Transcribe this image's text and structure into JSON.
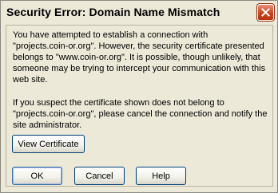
{
  "window": {
    "title": "Security Error: Domain Name Mismatch"
  },
  "message": {
    "paragraph1": "You have attempted to establish a connection with\n\"projects.coin-or.org\". However, the security certificate presented\nbelongs to \"www.coin-or.org\". It is possible, though unlikely, that\nsomeone may be trying to intercept your communication with this\nweb site.",
    "paragraph2": "If you suspect the certificate shown does not belong to\n\"projects.coin-or.org\", please cancel the connection and notify the\nsite administrator."
  },
  "buttons": {
    "view_certificate": "View Certificate",
    "ok": "OK",
    "cancel": "Cancel",
    "help": "Help"
  },
  "icons": {
    "close": "close-icon"
  },
  "colors": {
    "dialog_background": "#ece9d8",
    "close_button": "#c8461f"
  }
}
